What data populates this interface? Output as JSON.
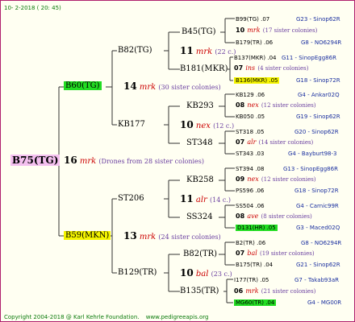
{
  "header": {
    "date": "10-  2-2018 ( 20: 45)"
  },
  "root": {
    "label": "B75(TG)",
    "count": "16",
    "mark": "mrk",
    "note": "(Drones from 28 sister colonies)"
  },
  "gen1": [
    {
      "label": "B60(TG)",
      "count": "14",
      "mark": "mrk",
      "note": "(30 sister colonies)"
    },
    {
      "label": "B59(MKN)",
      "count": "13",
      "mark": "mrk",
      "note": "(24 sister colonies)"
    }
  ],
  "gen2": [
    {
      "label": "B82(TG)",
      "count": "11",
      "mark": "mrk",
      "note": "(22 c.)"
    },
    {
      "label": "KB177",
      "count": "10",
      "mark": "nex",
      "note": "(12 c.)"
    },
    {
      "label": "ST206",
      "count": "11",
      "mark": "alr",
      "note": "(14 c.)"
    },
    {
      "label": "B129(TR)",
      "count": "10",
      "mark": "bal",
      "note": "(23 c.)"
    }
  ],
  "gen3": [
    "B45(TG)",
    "B181(MKR)",
    "KB293",
    "ST348",
    "KB258",
    "SS324",
    "B82(TR)",
    "B135(TR)"
  ],
  "gen4": [
    {
      "top": "B99(TG) .07",
      "top_code": "G23 - Sinop62R",
      "count": "10",
      "mark": "mrk",
      "note": "(17 sister colonies)",
      "bottom": "B179(TR) .06",
      "bottom_code": "G8 - NO6294R"
    },
    {
      "top": "B137(MKR) .04",
      "top_code": "G11 - SinopEgg86R",
      "count": "07",
      "mark": "ins",
      "note": "(4 sister colonies)",
      "bottom": "B136(MKR) .05",
      "bottom_code": "G18 - Sinop72R"
    },
    {
      "top": "KB129 .06",
      "top_code": "G4 - Ankar02Q",
      "count": "08",
      "mark": "nex",
      "note": "(12 sister colonies)",
      "bottom": "KB050 .05",
      "bottom_code": "G19 - Sinop62R"
    },
    {
      "top": "ST318 .05",
      "top_code": "G20 - Sinop62R",
      "count": "07",
      "mark": "alr",
      "note": "(14 sister colonies)",
      "bottom": "ST343 .03",
      "bottom_code": "G4 - Bayburt98-3"
    },
    {
      "top": "ST394 .08",
      "top_code": "G13 - SinopEgg86R",
      "count": "09",
      "mark": "nex",
      "note": "(12 sister colonies)",
      "bottom": "PS596 .06",
      "bottom_code": "G18 - Sinop72R"
    },
    {
      "top": "SS504 .06",
      "top_code": "G4 - Carnic99R",
      "count": "08",
      "mark": "ave",
      "note": "(8 sister colonies)",
      "bottom": "D131(HR) .05",
      "bottom_code": "G3 - Maced02Q"
    },
    {
      "top": "B2(TR) .06",
      "top_code": "G8 - NO6294R",
      "count": "07",
      "mark": "bal",
      "note": "(19 sister colonies)",
      "bottom": "B175(TR) .04",
      "bottom_code": "G21 - Sinop62R"
    },
    {
      "top": "I177(TR) .05",
      "top_code": "G7 - Takab93aR",
      "count": "06",
      "mark": "mrk",
      "note": "(21 sister colonies)",
      "bottom": "MG60(TR) .04",
      "bottom_code": "G4 - MG00R"
    }
  ],
  "footer": {
    "copyright": "Copyright 2004-2018 @ Karl Kehrle Foundation.",
    "site": "www.pedigreeapis.org"
  },
  "colors": {
    "highlight_green": "#22dd22",
    "highlight_yellow": "#f4f400",
    "highlight_pink": "#f4c0ef",
    "mark_red": "#cc0000",
    "note_purple": "#6a3fa0",
    "code_blue": "#1a2f9f",
    "frame": "#b0206e"
  }
}
